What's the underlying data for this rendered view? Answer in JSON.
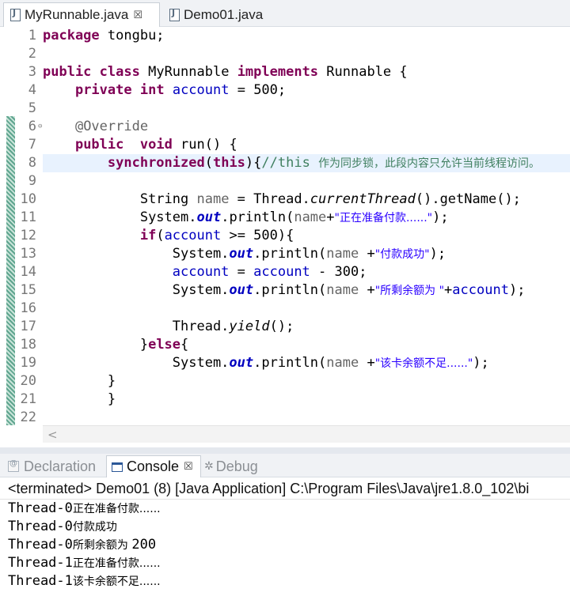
{
  "editor_tabs": [
    {
      "label": "MyRunnable.java",
      "active": true,
      "close": "☒"
    },
    {
      "label": "Demo01.java",
      "active": false
    }
  ],
  "line_numbers": [
    "1",
    "2",
    "3",
    "4",
    "5",
    "6",
    "7",
    "8",
    "9",
    "10",
    "11",
    "12",
    "13",
    "14",
    "15",
    "16",
    "17",
    "18",
    "19",
    "20",
    "21",
    "22"
  ],
  "code": {
    "l1_kw": "package",
    "l1_rest": " tongbu;",
    "l3_kw1": "public",
    "l3_kw2": "class",
    "l3_name": " MyRunnable ",
    "l3_kw3": "implements",
    "l3_iface": " Runnable {",
    "l4_kw1": "private",
    "l4_kw2": "int",
    "l4_field": "account",
    "l4_rest": " = 500;",
    "l6_ann": "@Override",
    "l7_kw1": "public",
    "l7_kw2": "void",
    "l7_rest": " run() {",
    "l8_kw1": "synchronized",
    "l8_p1": "(",
    "l8_kw2": "this",
    "l8_p2": "){",
    "l8_com": "//this ",
    "l8_com_cjk": "作为同步锁，此段内容只允许当前线程访问。",
    "l10_a": "String ",
    "l10_var": "name",
    "l10_b": " = Thread.",
    "l10_m": "currentThread",
    "l10_c": "().getName();",
    "l11_a": "System.",
    "l11_out": "out",
    "l11_b": ".println(",
    "l11_var": "name",
    "l11_c": "+",
    "l11_str": "\"正在准备付款......\"",
    "l11_d": ");",
    "l12_kw": "if",
    "l12_a": "(",
    "l12_field": "account",
    "l12_b": " >= 500){",
    "l13_a": "System.",
    "l13_out": "out",
    "l13_b": ".println(",
    "l13_var": "name",
    "l13_c": " +",
    "l13_str": "\"付款成功\"",
    "l13_d": ");",
    "l14_f1": "account",
    "l14_a": " = ",
    "l14_f2": "account",
    "l14_b": " - 300;",
    "l15_a": "System.",
    "l15_out": "out",
    "l15_b": ".println(",
    "l15_var": "name",
    "l15_c": " +",
    "l15_str": "\"所剩余额为 \"",
    "l15_d": "+",
    "l15_field": "account",
    "l15_e": ");",
    "l17_a": "Thread.",
    "l17_m": "yield",
    "l17_b": "();",
    "l18_a": "}",
    "l18_kw": "else",
    "l18_b": "{",
    "l19_a": "System.",
    "l19_out": "out",
    "l19_b": ".println(",
    "l19_var": "name",
    "l19_c": " +",
    "l19_str": "\"该卡余额不足......\"",
    "l19_d": ");",
    "l20": "}",
    "l21": "}"
  },
  "scroll_left_arrow": "<",
  "panel_tabs": [
    {
      "label": "Declaration",
      "active": false
    },
    {
      "label": "Console",
      "active": true,
      "close": "☒"
    },
    {
      "label": "Debug",
      "active": false
    }
  ],
  "console": {
    "status": "<terminated> Demo01 (8) [Java Application] C:\\Program Files\\Java\\jre1.8.0_102\\bi",
    "output": [
      {
        "tid": "Thread-0",
        "msg": "正在准备付款......",
        "num": ""
      },
      {
        "tid": "Thread-0",
        "msg": "付款成功",
        "num": ""
      },
      {
        "tid": "Thread-0",
        "msg": "所剩余额为 ",
        "num": "200"
      },
      {
        "tid": "Thread-1",
        "msg": "正在准备付款......",
        "num": ""
      },
      {
        "tid": "Thread-1",
        "msg": "该卡余额不足......",
        "num": ""
      }
    ]
  },
  "colors": {
    "keyword": "#7f0055",
    "field": "#0000c0",
    "string": "#2a00ff",
    "comment": "#3f7f5f",
    "annotation": "#646464",
    "current_line": "#e8f2fe"
  }
}
